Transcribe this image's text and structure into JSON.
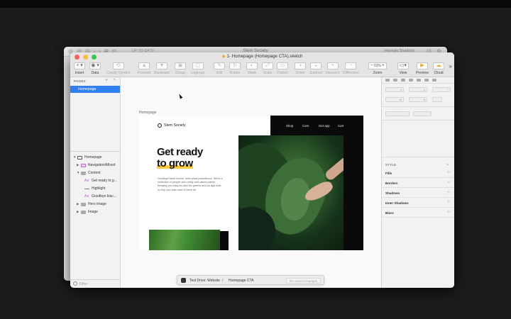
{
  "back_window": {
    "label": "UP TO DATE",
    "title": "Stem Society",
    "user": "Hannah Shadrick"
  },
  "window": {
    "title": "1- Homepage (Homepage CTA).sketch"
  },
  "toolbar": {
    "items": [
      {
        "label": "Insert",
        "glyph": "+ ▾",
        "dim": false
      },
      {
        "label": "Data",
        "glyph": "◉ ▾",
        "dim": false
      },
      {
        "label": "Create Symbol",
        "glyph": "⟲",
        "dim": true
      },
      {
        "label": "Forward",
        "glyph": "▲",
        "dim": true
      },
      {
        "label": "Backward",
        "glyph": "▼",
        "dim": true
      },
      {
        "label": "Group",
        "glyph": "▣",
        "dim": true
      },
      {
        "label": "Ungroup",
        "glyph": "▢",
        "dim": true
      },
      {
        "label": "Edit",
        "glyph": "✎",
        "dim": true
      },
      {
        "label": "Rotate",
        "glyph": "↻",
        "dim": true
      },
      {
        "label": "Mask",
        "glyph": "◐",
        "dim": true
      },
      {
        "label": "Scale",
        "glyph": "⤢",
        "dim": true
      },
      {
        "label": "Flatten",
        "glyph": "▭",
        "dim": true
      },
      {
        "label": "Union",
        "glyph": "◑",
        "dim": true
      },
      {
        "label": "Subtract",
        "glyph": "◒",
        "dim": true
      },
      {
        "label": "Intersect",
        "glyph": "◓",
        "dim": true
      },
      {
        "label": "Difference",
        "glyph": "◔",
        "dim": true
      }
    ],
    "zoom": {
      "label": "Zoom",
      "value": "53%"
    },
    "view_label": "View",
    "preview_label": "Preview",
    "cloud_label": "Cloud",
    "more": "»"
  },
  "left_panel": {
    "pages_header": "PAGES",
    "selected_page": "Homepage",
    "layers": [
      {
        "name": "Homepage",
        "icon": "monitor",
        "indent": 0,
        "expanded": true,
        "bold": false
      },
      {
        "name": "Navigation/Mixed",
        "icon": "symbol",
        "indent": 1,
        "expanded": false
      },
      {
        "name": "Content",
        "icon": "folder",
        "indent": 1,
        "expanded": true
      },
      {
        "name": "Get ready to g...",
        "icon": "text",
        "indent": 2
      },
      {
        "name": "Highlight",
        "icon": "line",
        "indent": 2
      },
      {
        "name": "Goodbye blac...",
        "icon": "text",
        "indent": 2
      },
      {
        "name": "Hero image",
        "icon": "folder",
        "indent": 1,
        "expanded": false
      },
      {
        "name": "Image",
        "icon": "folder",
        "indent": 1,
        "expanded": false
      }
    ],
    "filter_placeholder": "Filter"
  },
  "canvas": {
    "artboard_label": "Homepage",
    "brand": "Stem Society",
    "nav": [
      "Shop",
      "Care",
      "Get app",
      "Cart"
    ],
    "headline_line1": "Get ready",
    "headline_line2": "to grow",
    "body": "Goodbye black thumb, hello plant parenthood. We're a collective of people who really care about plants, bringing you easy-to-care-for greens and an app built to help you take care of them all."
  },
  "status_bar": {
    "workspace": "Test Drive: Website",
    "separator": "/",
    "document": "Homepage CTA",
    "changes": "No Saved Changes"
  },
  "inspector": {
    "style_header": "STYLE",
    "sections": [
      "Fills",
      "Borders",
      "Shadows",
      "Inner Shadows",
      "Blurs"
    ]
  },
  "colors": {
    "selection": "#2f7ff0",
    "highlight": "#ffcc3a",
    "traffic_red": "#fc605b",
    "traffic_yellow": "#fdbc40",
    "traffic_green": "#34c84a"
  }
}
